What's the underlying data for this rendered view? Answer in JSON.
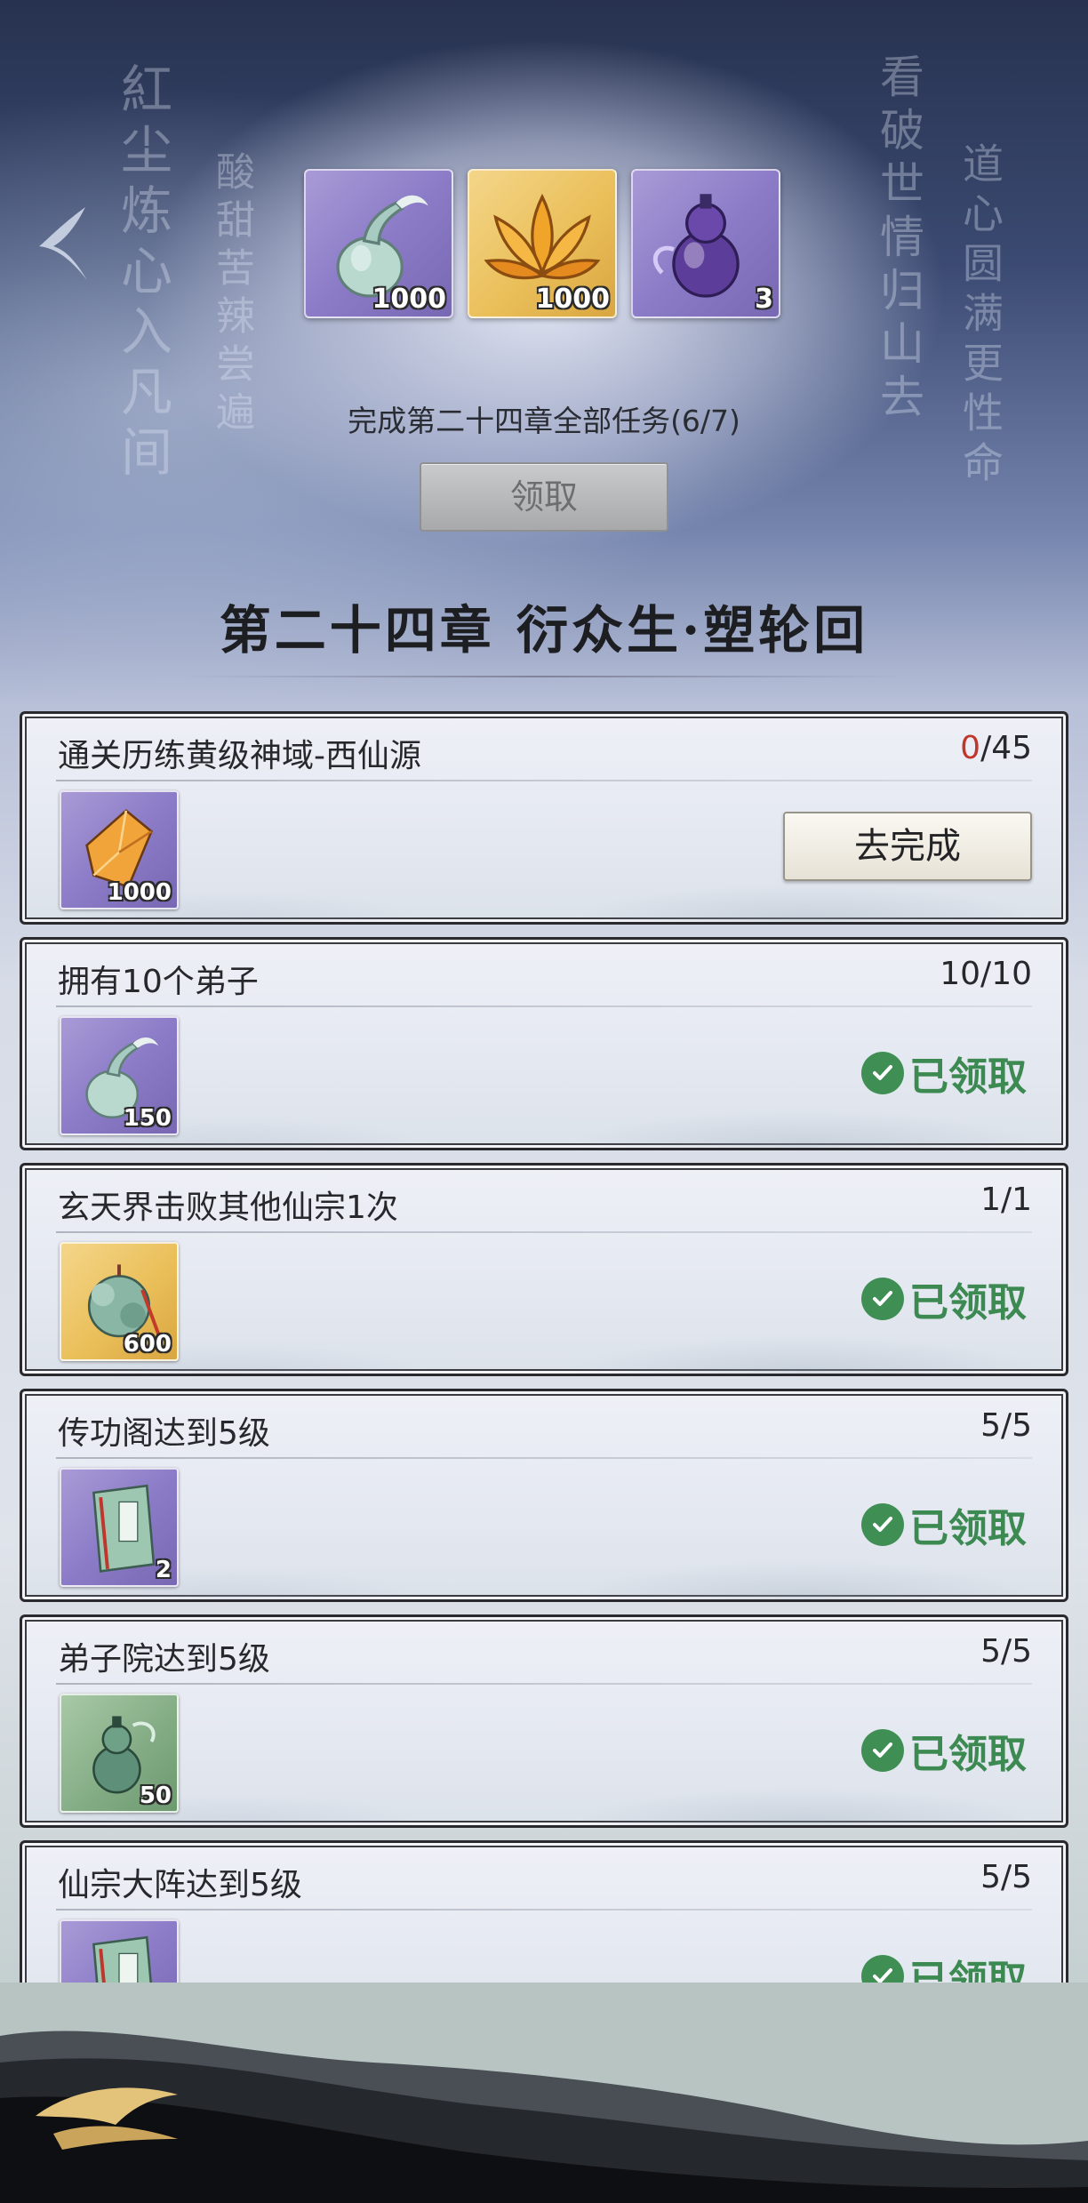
{
  "background": {
    "calligraphy": [
      "紅尘炼心入凡间",
      "酸甜苦辣尝遍",
      "看破世情归山去",
      "道心圆满更性命"
    ]
  },
  "top_rewards": [
    {
      "icon": "jade-vase-icon",
      "bg": "purple",
      "count": "1000"
    },
    {
      "icon": "golden-lotus-icon",
      "bg": "gold",
      "count": "1000"
    },
    {
      "icon": "purple-gourd-icon",
      "bg": "purple",
      "count": "3"
    }
  ],
  "chapter": {
    "progress_text": "完成第二十四章全部任务(6/7)",
    "claim_label": "领取",
    "title": "第二十四章 衍众生·塑轮回"
  },
  "tasks": [
    {
      "name": "通关历练黄级神域-西仙源",
      "progress_current": "0",
      "progress_total": "/45",
      "item_icon": "amber-crystal-icon",
      "item_bg": "purple",
      "item_count": "1000",
      "action": "去完成",
      "state": "todo"
    },
    {
      "name": "拥有10个弟子",
      "progress": "10/10",
      "item_icon": "jade-vase-icon",
      "item_bg": "purple",
      "item_count": "150",
      "action": "已领取",
      "state": "claimed"
    },
    {
      "name": "玄天界击败其他仙宗1次",
      "progress": "1/1",
      "item_icon": "spirit-pouch-icon",
      "item_bg": "gold",
      "item_count": "600",
      "action": "已领取",
      "state": "claimed"
    },
    {
      "name": "传功阁达到5级",
      "progress": "5/5",
      "item_icon": "manual-book-icon",
      "item_bg": "purple",
      "item_count": "2",
      "action": "已领取",
      "state": "claimed"
    },
    {
      "name": "弟子院达到5级",
      "progress": "5/5",
      "item_icon": "green-gourd-icon",
      "item_bg": "green",
      "item_count": "50",
      "action": "已领取",
      "state": "claimed"
    },
    {
      "name": "仙宗大阵达到5级",
      "progress": "5/5",
      "item_icon": "manual-book-icon",
      "item_bg": "purple",
      "item_count": "",
      "action": "已领取",
      "state": "claimed"
    }
  ],
  "colors": {
    "claimed_green": "#3c8a52",
    "progress_red": "#c0362c"
  }
}
